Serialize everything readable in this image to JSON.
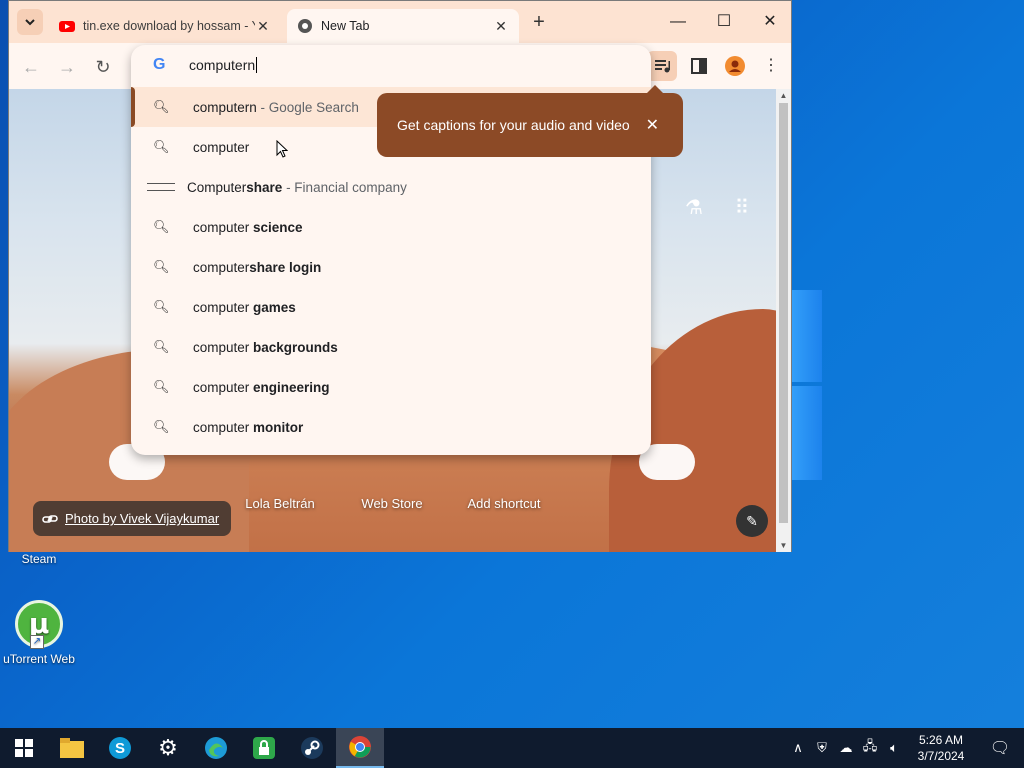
{
  "desktop": {
    "icons": [
      {
        "label": "Steam"
      },
      {
        "label": "uTorrent Web"
      }
    ]
  },
  "browser": {
    "tabs": [
      {
        "title": "tin.exe download by hossam - YouTube",
        "icon": "youtube-icon",
        "active": false
      },
      {
        "title": "New Tab",
        "icon": "chrome-icon",
        "active": true
      }
    ],
    "omnibox": {
      "value": "computern",
      "suggestions": [
        {
          "prefix": "computern",
          "bold": "",
          "desc": " - Google Search",
          "icon": "search-icon",
          "selected": true
        },
        {
          "prefix": "computer",
          "bold": "",
          "desc": "",
          "icon": "search-icon"
        },
        {
          "prefix": "Computer",
          "bold": "share",
          "desc": " - Financial company",
          "icon": "computershare-logo"
        },
        {
          "prefix": "computer ",
          "bold": "science",
          "desc": "",
          "icon": "search-icon"
        },
        {
          "prefix": "computer",
          "bold": "share login",
          "desc": "",
          "icon": "search-icon"
        },
        {
          "prefix": "computer ",
          "bold": "games",
          "desc": "",
          "icon": "search-icon"
        },
        {
          "prefix": "computer ",
          "bold": "backgrounds",
          "desc": "",
          "icon": "search-icon"
        },
        {
          "prefix": "computer ",
          "bold": "engineering",
          "desc": "",
          "icon": "search-icon"
        },
        {
          "prefix": "computer ",
          "bold": "monitor",
          "desc": "",
          "icon": "search-icon"
        }
      ]
    },
    "tooltip": {
      "text": "Get captions for your audio and video"
    },
    "ntp": {
      "shortcuts": [
        {
          "label": "Lola Beltrán"
        },
        {
          "label": "Web Store"
        },
        {
          "label": "Add shortcut"
        }
      ],
      "photo_credit": "Photo by Vivek Vijaykumar"
    }
  },
  "taskbar": {
    "clock": {
      "time": "5:26 AM",
      "date": "3/7/2024"
    }
  },
  "colors": {
    "accent": "#8c4a26",
    "taskbar": "#0f1b2e",
    "desktop": "#0a63c9"
  }
}
